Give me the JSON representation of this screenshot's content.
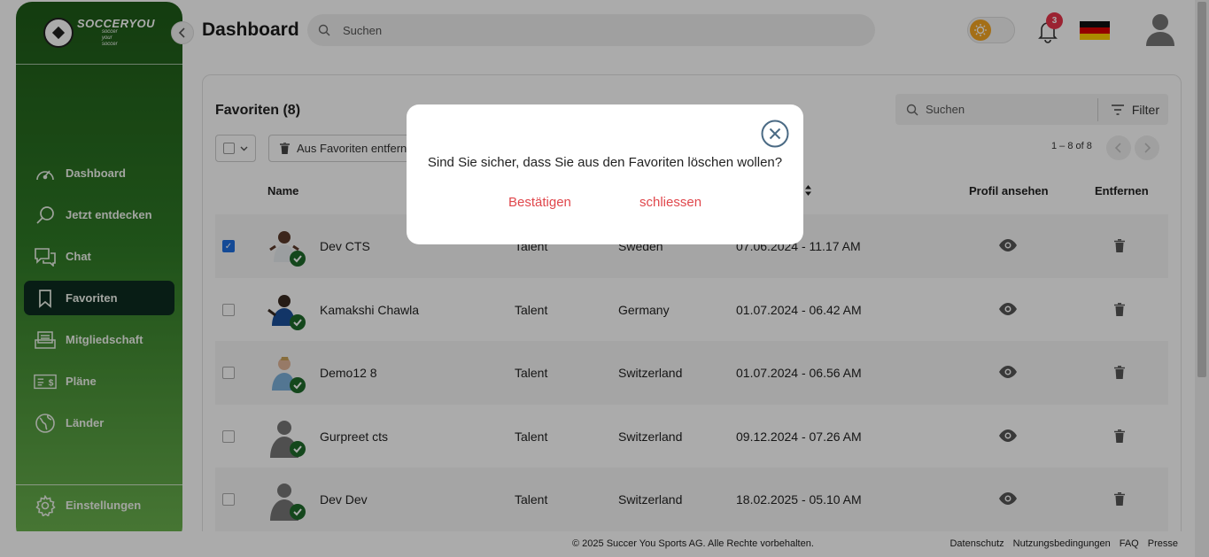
{
  "header": {
    "title": "Dashboard",
    "search_placeholder": "Suchen",
    "notification_count": "3"
  },
  "logo": {
    "name": "SOCCERYOU",
    "slogan_1": "soccer",
    "slogan_2": "your",
    "slogan_3": "soccer"
  },
  "sidebar": {
    "items": [
      {
        "label": "Dashboard",
        "icon": "gauge-icon"
      },
      {
        "label": "Jetzt entdecken",
        "icon": "search-icon"
      },
      {
        "label": "Chat",
        "icon": "chat-icon"
      },
      {
        "label": "Favoriten",
        "icon": "bookmark-icon",
        "active": true
      },
      {
        "label": "Mitgliedschaft",
        "icon": "membership-icon"
      },
      {
        "label": "Pläne",
        "icon": "plans-icon"
      },
      {
        "label": "Länder",
        "icon": "globe-icon"
      }
    ],
    "settings_label": "Einstellungen"
  },
  "favorites": {
    "title": "Favoriten (8)",
    "search_placeholder": "Suchen",
    "filter_label": "Filter",
    "remove_label": "Aus Favoriten entfernen",
    "pagination": "1 – 8 of 8",
    "columns": {
      "name": "Name",
      "view": "Profil ansehen",
      "remove": "Entfernen"
    },
    "rows": [
      {
        "name": "Dev CTS",
        "type": "Talent",
        "country": "Sweden",
        "date": "07.06.2024 - 11.17 AM",
        "checked": true
      },
      {
        "name": "Kamakshi Chawla",
        "type": "Talent",
        "country": "Germany",
        "date": "01.07.2024 - 06.42 AM",
        "checked": false
      },
      {
        "name": "Demo12 8",
        "type": "Talent",
        "country": "Switzerland",
        "date": "01.07.2024 - 06.56 AM",
        "checked": false
      },
      {
        "name": "Gurpreet cts",
        "type": "Talent",
        "country": "Switzerland",
        "date": "09.12.2024 - 07.26 AM",
        "checked": false
      },
      {
        "name": "Dev Dev",
        "type": "Talent",
        "country": "Switzerland",
        "date": "18.02.2025 - 05.10 AM",
        "checked": false
      }
    ]
  },
  "modal": {
    "message": "Sind Sie sicher, dass Sie aus den Favoriten löschen wollen?",
    "confirm": "Bestätigen",
    "close": "schliessen"
  },
  "footer": {
    "copyright": "© 2025 Succer You Sports AG. Alle Rechte vorbehalten.",
    "links": [
      "Datenschutz",
      "Nutzungsbedingungen",
      "FAQ",
      "Presse"
    ]
  },
  "colors": {
    "sidebar_dark": "#1e5a18",
    "sidebar_light": "#6cb24f",
    "active_nav": "#0d2c20",
    "accent_red": "#e0474c",
    "checkbox_blue": "#1e6fe0",
    "badge_red": "#e8334a"
  }
}
